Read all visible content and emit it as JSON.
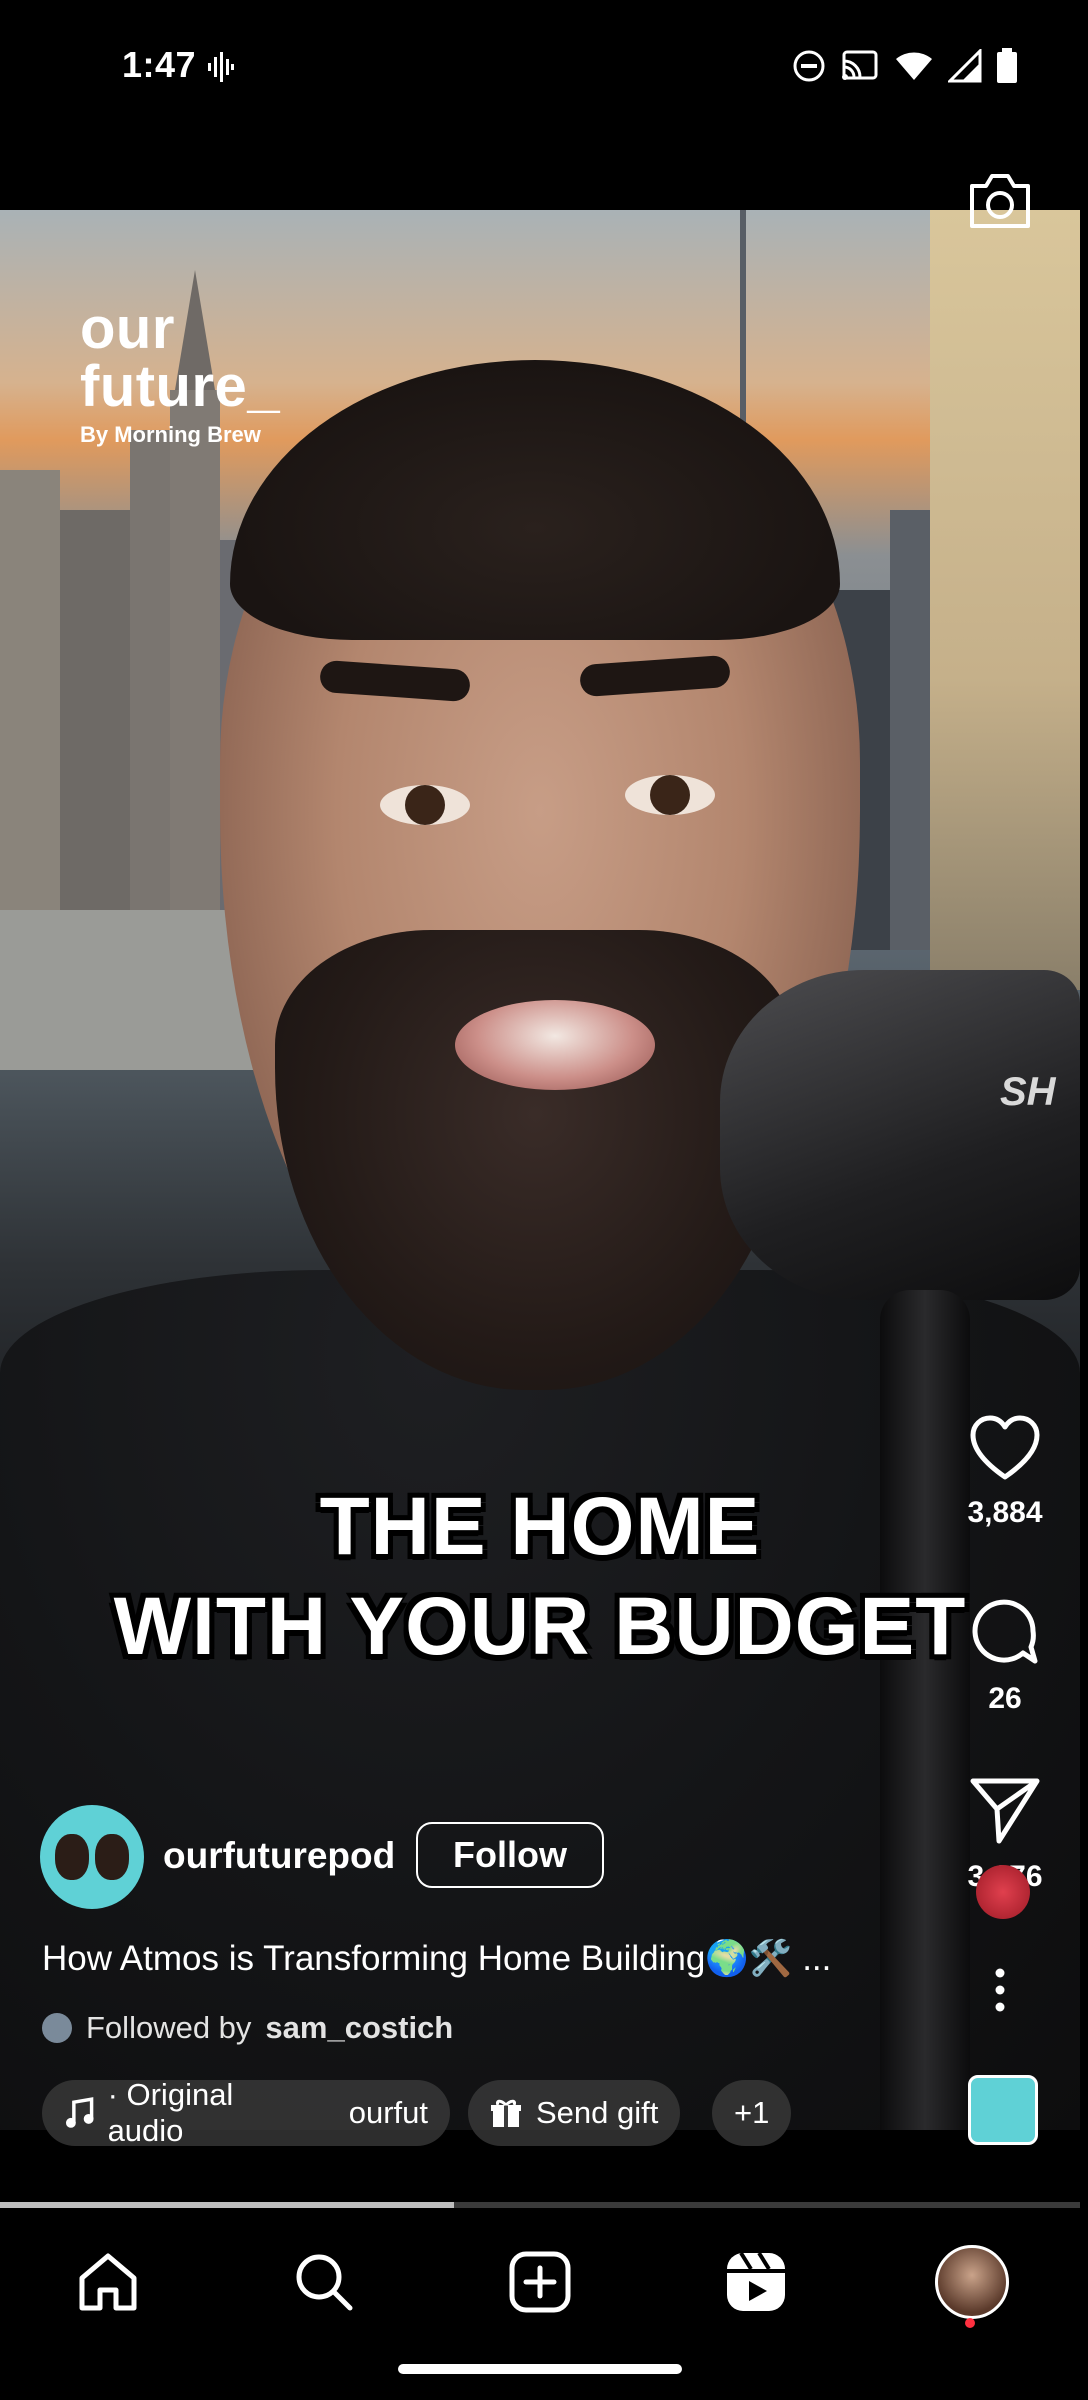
{
  "status_bar": {
    "time": "1:47"
  },
  "video": {
    "brand_line1": "our",
    "brand_line2": "future_",
    "brand_line3": "By Morning Brew",
    "caption_line1": "THE HOME",
    "caption_line2": "WITH YOUR BUDGET",
    "mic_label": "SH"
  },
  "actions": {
    "likes": "3,884",
    "comments": "26",
    "shares": "3,076"
  },
  "post": {
    "username": "ourfuturepod",
    "follow_label": "Follow",
    "description": "How Atmos is Transforming Home Building🌍🛠️ ...",
    "followed_by_prefix": "Followed by",
    "followed_by_user": "sam_costich"
  },
  "chips": {
    "audio_label": "· Original audio",
    "audio_user": "ourfut",
    "gift_label": "Send gift",
    "more_label": "+1"
  },
  "playback": {
    "progress": 0.42
  },
  "colors": {
    "accent_notif": "#ff3040",
    "avatar_bg": "#5fd1d6"
  }
}
